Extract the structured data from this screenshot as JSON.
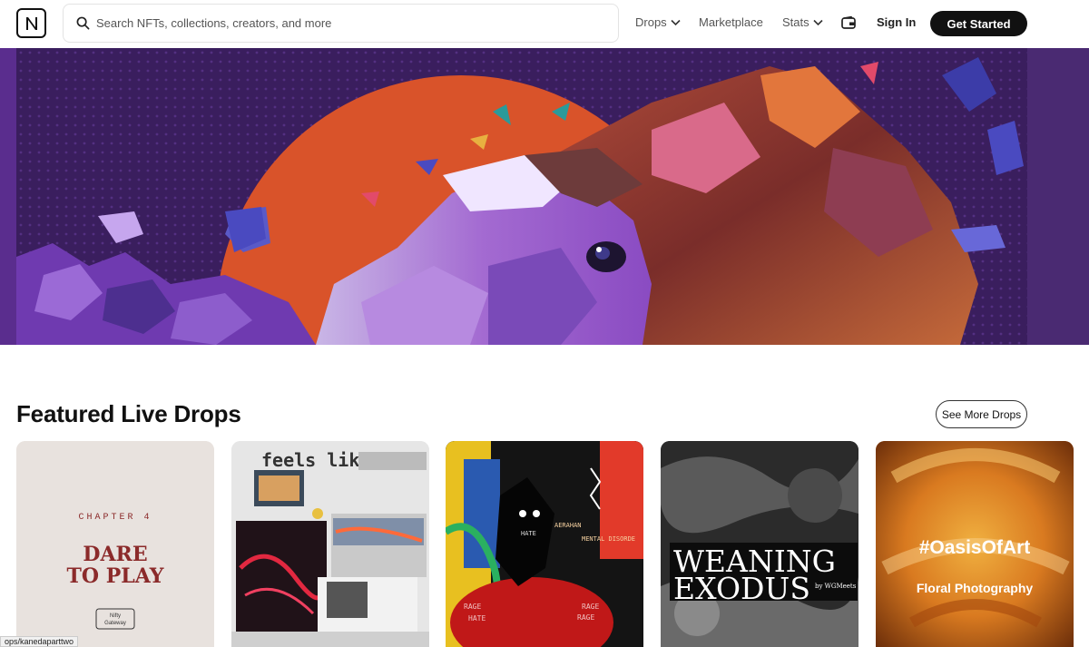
{
  "header": {
    "logo_letter": "N",
    "search_placeholder": "Search NFTs, collections, creators, and more",
    "nav": {
      "drops": "Drops",
      "marketplace": "Marketplace",
      "stats": "Stats"
    },
    "sign_in": "Sign In",
    "get_started": "Get Started"
  },
  "section": {
    "title": "Featured Live Drops",
    "see_more": "See More Drops"
  },
  "cards": [
    {
      "chapter": "CHAPTER 4",
      "line1": "DARE",
      "line2": "TO PLAY",
      "badge_line1": "Nifty",
      "badge_line2": "Gateway"
    },
    {
      "headline": "feels like"
    },
    {
      "caption_top": "AERAHAN",
      "caption_mid": "MENTAL DISORDE",
      "side_word": "HATE",
      "rage1": "RAGE",
      "hate": "HATE",
      "rage2": "RAGE",
      "rage3": "RAGE"
    },
    {
      "line1": "WEANING",
      "line2": "EXODUS",
      "byline": "by WGMeets"
    },
    {
      "hashtag": "#OasisOfArt",
      "subtitle": "Floral Photography"
    }
  ],
  "status_url": "ops/kanedaparttwo",
  "colors": {
    "accent": "#111111",
    "hero_purple": "#3c1f60",
    "hero_orange": "#d9532a"
  }
}
